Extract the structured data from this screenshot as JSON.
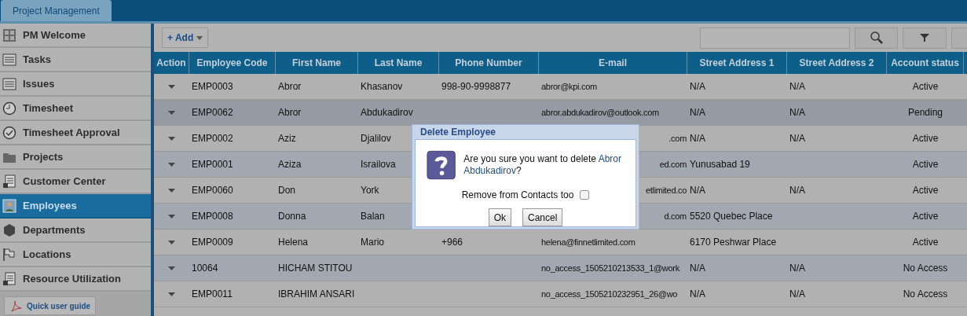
{
  "app_tab": {
    "label": "Project Management",
    "selected": true
  },
  "sidebar": {
    "items": [
      {
        "label": "PM Welcome",
        "selected": false
      },
      {
        "label": "Tasks",
        "selected": false
      },
      {
        "label": "Issues",
        "selected": false
      },
      {
        "label": "Timesheet",
        "selected": false
      },
      {
        "label": "Timesheet Approval",
        "selected": false
      },
      {
        "label": "Projects",
        "selected": false
      },
      {
        "label": "Customer Center",
        "selected": false
      },
      {
        "label": "Employees",
        "selected": true
      },
      {
        "label": "Departments",
        "selected": false
      },
      {
        "label": "Locations",
        "selected": false
      },
      {
        "label": "Resource Utilization",
        "selected": false
      }
    ],
    "guide_button": "Quick user guide"
  },
  "toolbar": {
    "add_button": "+ Add"
  },
  "table": {
    "columns": [
      "Action",
      "Employee Code",
      "First Name",
      "Last Name",
      "Phone Number",
      "E-mail",
      "Street Address 1",
      "Street Address 2",
      "Account status"
    ],
    "rows": [
      {
        "selected": false,
        "cells": [
          "",
          "EMP0003",
          "Abror",
          "Khasanov",
          "998-90-9998877",
          "abror@kpi.com",
          "N/A",
          "N/A",
          "Active"
        ]
      },
      {
        "selected": true,
        "cells": [
          "",
          "EMP0062",
          "Abror",
          "Abdukadirov",
          "",
          "abror.abdukadirov@outlook.com",
          "N/A",
          "N/A",
          "Pending"
        ]
      },
      {
        "selected": false,
        "cells": [
          "",
          "EMP0002",
          "Aziz",
          "Djalilov",
          "",
          ".com",
          "N/A",
          "N/A",
          "Active"
        ]
      },
      {
        "selected": false,
        "cells": [
          "",
          "EMP0001",
          "Aziza",
          "Israilova",
          "",
          "ed.com",
          "Yunusabad 19",
          "",
          "Active"
        ]
      },
      {
        "selected": false,
        "cells": [
          "",
          "EMP0060",
          "Don",
          "York",
          "",
          "etlimited.co",
          "N/A",
          "N/A",
          "Active"
        ]
      },
      {
        "selected": false,
        "cells": [
          "",
          "EMP0008",
          "Donna",
          "Balan",
          "",
          "d.com",
          "5520 Quebec Place",
          "",
          "Active"
        ]
      },
      {
        "selected": false,
        "cells": [
          "",
          "EMP0009",
          "Helena",
          "Mario",
          "+966",
          "helena@finnetlimited.com",
          "6170 Peshwar Place",
          "",
          "Active"
        ]
      },
      {
        "selected": false,
        "cells": [
          "",
          "10064",
          "HICHAM STITOU",
          "",
          "",
          "no_access_1505210213533_1@work",
          "N/A",
          "N/A",
          "No Access"
        ]
      },
      {
        "selected": false,
        "cells": [
          "",
          "EMP0011",
          "IBRAHIM ANSARI",
          "",
          "",
          "no_access_1505210232951_26@wo",
          "N/A",
          "N/A",
          "No Access"
        ]
      }
    ]
  },
  "dialog": {
    "title": "Delete Employee",
    "message_prefix": "Are you sure you want to delete",
    "employee_name": "Abror Abdukadirov",
    "message_suffix": "?",
    "checkbox": {
      "label": "Remove from Contacts too",
      "checked": false
    },
    "buttons": [
      "Ok",
      "Cancel"
    ]
  }
}
